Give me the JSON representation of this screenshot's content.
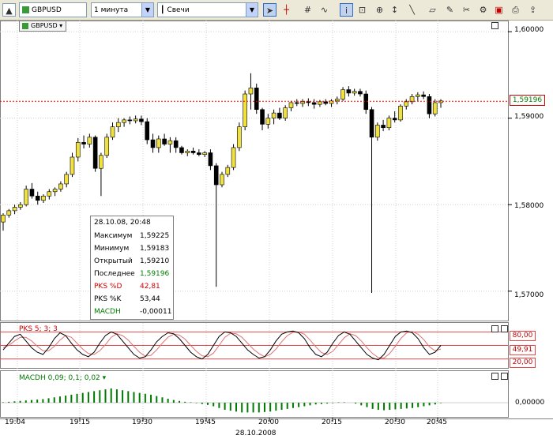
{
  "toolbar": {
    "symbol": "GBPUSD",
    "interval": "1 минута",
    "chart_type": "Свечи"
  },
  "chart": {
    "symbol_badge": "GBPUSD",
    "price_labels": [
      "1,60000",
      "1,59000",
      "1,58000",
      "1,57000"
    ],
    "last_price": "1,59196",
    "time_labels": [
      "19:04",
      "19:15",
      "19:30",
      "19:45",
      "20:00",
      "20:15",
      "20:30",
      "20:45"
    ],
    "date_label": "28.10.2008"
  },
  "info": {
    "datetime": "28.10.08, 20:48",
    "rows": [
      {
        "label": "Максимум",
        "value": "1,59225"
      },
      {
        "label": "Минимум",
        "value": "1,59183"
      },
      {
        "label": "Открытый",
        "value": "1,59210"
      },
      {
        "label": "Последнее",
        "value": "1,59196"
      },
      {
        "label": "PKS %D",
        "value": "42,81"
      },
      {
        "label": "PKS %K",
        "value": "53,44"
      },
      {
        "label": "MACDH",
        "value": "-0,00011"
      }
    ]
  },
  "stochastic": {
    "title": "PKS 5; 3; 3",
    "levels": [
      "80,00",
      "49,91",
      "20,00"
    ]
  },
  "macd": {
    "title": "MACDH 0,09; 0,1; 0,02",
    "zero_label": "0,00000"
  },
  "colors": {
    "up_candle": "#f0e040",
    "down_candle": "#000000",
    "last_line": "#ff0000",
    "macd": "#007a00"
  },
  "chart_data": {
    "type": "candlestick",
    "xlabel": "",
    "ylabel": "",
    "ylim": [
      1.5666,
      1.6012
    ],
    "last": 1.59196,
    "candles": [
      [
        1.578,
        1.579,
        1.577,
        1.5788
      ],
      [
        1.5788,
        1.5795,
        1.5785,
        1.5793
      ],
      [
        1.5793,
        1.58,
        1.5789,
        1.5797
      ],
      [
        1.5797,
        1.5803,
        1.5794,
        1.58
      ],
      [
        1.58,
        1.5822,
        1.5798,
        1.5818
      ],
      [
        1.5818,
        1.5825,
        1.5807,
        1.581
      ],
      [
        1.581,
        1.5815,
        1.58,
        1.5805
      ],
      [
        1.5805,
        1.5812,
        1.5802,
        1.581
      ],
      [
        1.581,
        1.5818,
        1.5806,
        1.5815
      ],
      [
        1.5815,
        1.582,
        1.581,
        1.5818
      ],
      [
        1.5818,
        1.5827,
        1.5815,
        1.5824
      ],
      [
        1.5824,
        1.5838,
        1.582,
        1.5835
      ],
      [
        1.5835,
        1.586,
        1.5832,
        1.5855
      ],
      [
        1.5855,
        1.5877,
        1.585,
        1.5872
      ],
      [
        1.5872,
        1.588,
        1.5865,
        1.587
      ],
      [
        1.587,
        1.5882,
        1.5866,
        1.5878
      ],
      [
        1.5878,
        1.588,
        1.5838,
        1.5842
      ],
      [
        1.5842,
        1.586,
        1.581,
        1.5857
      ],
      [
        1.5857,
        1.5882,
        1.5854,
        1.5878
      ],
      [
        1.5878,
        1.5895,
        1.5875,
        1.589
      ],
      [
        1.589,
        1.59,
        1.5884,
        1.5895
      ],
      [
        1.5895,
        1.59,
        1.589,
        1.5898
      ],
      [
        1.5898,
        1.5902,
        1.5893,
        1.5897
      ],
      [
        1.5897,
        1.5903,
        1.5894,
        1.5899
      ],
      [
        1.5899,
        1.5903,
        1.5892,
        1.5896
      ],
      [
        1.5896,
        1.59,
        1.587,
        1.5875
      ],
      [
        1.5875,
        1.5882,
        1.586,
        1.5866
      ],
      [
        1.5866,
        1.588,
        1.586,
        1.5876
      ],
      [
        1.5876,
        1.5882,
        1.5868,
        1.587
      ],
      [
        1.587,
        1.5878,
        1.586,
        1.5874
      ],
      [
        1.5874,
        1.5878,
        1.586,
        1.5866
      ],
      [
        1.5866,
        1.5868,
        1.5858,
        1.586
      ],
      [
        1.586,
        1.5864,
        1.5856,
        1.5862
      ],
      [
        1.5862,
        1.5866,
        1.5858,
        1.586
      ],
      [
        1.586,
        1.5864,
        1.5856,
        1.5858
      ],
      [
        1.5858,
        1.5862,
        1.5855,
        1.586
      ],
      [
        1.586,
        1.5864,
        1.584,
        1.5845
      ],
      [
        1.5845,
        1.5848,
        1.5705,
        1.5823
      ],
      [
        1.5823,
        1.5838,
        1.582,
        1.5835
      ],
      [
        1.5835,
        1.5846,
        1.5832,
        1.5843
      ],
      [
        1.5843,
        1.587,
        1.584,
        1.5866
      ],
      [
        1.5866,
        1.5895,
        1.5862,
        1.589
      ],
      [
        1.589,
        1.5932,
        1.5886,
        1.5928
      ],
      [
        1.5928,
        1.5952,
        1.591,
        1.5935
      ],
      [
        1.5935,
        1.594,
        1.5905,
        1.591
      ],
      [
        1.591,
        1.5912,
        1.5886,
        1.5893
      ],
      [
        1.5893,
        1.5905,
        1.5888,
        1.59
      ],
      [
        1.59,
        1.591,
        1.5893,
        1.5906
      ],
      [
        1.5906,
        1.5912,
        1.5898,
        1.59
      ],
      [
        1.59,
        1.5915,
        1.5897,
        1.5912
      ],
      [
        1.5912,
        1.592,
        1.5908,
        1.5918
      ],
      [
        1.5918,
        1.5922,
        1.5914,
        1.5917
      ],
      [
        1.5917,
        1.5922,
        1.5913,
        1.5919
      ],
      [
        1.5919,
        1.5923,
        1.5914,
        1.5918
      ],
      [
        1.5918,
        1.5922,
        1.5911,
        1.5916
      ],
      [
        1.5916,
        1.5921,
        1.5913,
        1.5919
      ],
      [
        1.5919,
        1.5922,
        1.5915,
        1.5917
      ],
      [
        1.5917,
        1.5922,
        1.5913,
        1.592
      ],
      [
        1.592,
        1.5925,
        1.5916,
        1.5922
      ],
      [
        1.5922,
        1.5936,
        1.592,
        1.5933
      ],
      [
        1.5933,
        1.5937,
        1.5925,
        1.5929
      ],
      [
        1.5929,
        1.5934,
        1.5926,
        1.5931
      ],
      [
        1.5931,
        1.5934,
        1.5925,
        1.5928
      ],
      [
        1.5928,
        1.5932,
        1.5905,
        1.591
      ],
      [
        1.591,
        1.5913,
        1.5698,
        1.5878
      ],
      [
        1.5878,
        1.5895,
        1.5874,
        1.5892
      ],
      [
        1.5892,
        1.5898,
        1.5885,
        1.5889
      ],
      [
        1.5889,
        1.5903,
        1.5886,
        1.59
      ],
      [
        1.59,
        1.5908,
        1.5895,
        1.5898
      ],
      [
        1.5898,
        1.5916,
        1.5896,
        1.5914
      ],
      [
        1.5914,
        1.5922,
        1.591,
        1.5919
      ],
      [
        1.5919,
        1.5928,
        1.5916,
        1.5925
      ],
      [
        1.5925,
        1.593,
        1.592,
        1.5927
      ],
      [
        1.5927,
        1.5931,
        1.5922,
        1.5925
      ],
      [
        1.5925,
        1.5928,
        1.59,
        1.5905
      ],
      [
        1.5905,
        1.5922,
        1.5902,
        1.5918
      ],
      [
        1.5918,
        1.5922,
        1.5912,
        1.592
      ]
    ],
    "stoch_k": [
      40,
      55,
      70,
      75,
      60,
      45,
      35,
      30,
      45,
      65,
      78,
      72,
      55,
      40,
      30,
      25,
      35,
      55,
      72,
      80,
      75,
      60,
      45,
      30,
      22,
      25,
      40,
      58,
      70,
      78,
      76,
      65,
      50,
      35,
      25,
      20,
      30,
      50,
      70,
      80,
      78,
      70,
      55,
      40,
      30,
      22,
      25,
      40,
      60,
      75,
      80,
      82,
      78,
      65,
      45,
      30,
      25,
      35,
      55,
      72,
      80,
      75,
      60,
      45,
      30,
      22,
      18,
      30,
      50,
      70,
      80,
      82,
      78,
      65,
      45,
      30,
      35,
      50
    ],
    "stoch_d": [
      45,
      50,
      60,
      68,
      68,
      60,
      48,
      38,
      38,
      48,
      62,
      72,
      68,
      55,
      42,
      32,
      30,
      38,
      52,
      68,
      76,
      72,
      62,
      48,
      35,
      26,
      28,
      40,
      55,
      68,
      75,
      73,
      64,
      50,
      37,
      27,
      25,
      33,
      50,
      68,
      77,
      76,
      68,
      55,
      42,
      32,
      25,
      30,
      42,
      58,
      72,
      79,
      80,
      75,
      62,
      47,
      34,
      30,
      37,
      52,
      67,
      76,
      72,
      60,
      45,
      32,
      23,
      22,
      32,
      48,
      66,
      78,
      81,
      75,
      63,
      47,
      38,
      42
    ],
    "macd_hist": [
      0.0001,
      0.0002,
      0.0003,
      0.0004,
      0.0005,
      0.0006,
      0.0007,
      0.0008,
      0.001,
      0.0012,
      0.0014,
      0.0016,
      0.0018,
      0.002,
      0.0022,
      0.0024,
      0.0026,
      0.0028,
      0.003,
      0.0032,
      0.003,
      0.0028,
      0.0026,
      0.0024,
      0.0022,
      0.002,
      0.0018,
      0.0015,
      0.0012,
      0.0009,
      0.0006,
      0.0004,
      0.0002,
      0.0001,
      -0.0001,
      -0.0003,
      -0.0005,
      -0.0008,
      -0.0012,
      -0.0016,
      -0.0018,
      -0.002,
      -0.0022,
      -0.0022,
      -0.0022,
      -0.0022,
      -0.0021,
      -0.002,
      -0.0018,
      -0.0016,
      -0.0014,
      -0.0012,
      -0.001,
      -0.0008,
      -0.0006,
      -0.0004,
      -0.0003,
      -0.0002,
      -0.0001,
      0.0001,
      0.0001,
      0.0,
      -0.0002,
      -0.0006,
      -0.001,
      -0.0014,
      -0.0016,
      -0.0017,
      -0.0016,
      -0.0015,
      -0.0014,
      -0.0013,
      -0.0012,
      -0.001,
      -0.0008,
      -0.0006,
      -0.0004,
      -0.0001
    ]
  }
}
